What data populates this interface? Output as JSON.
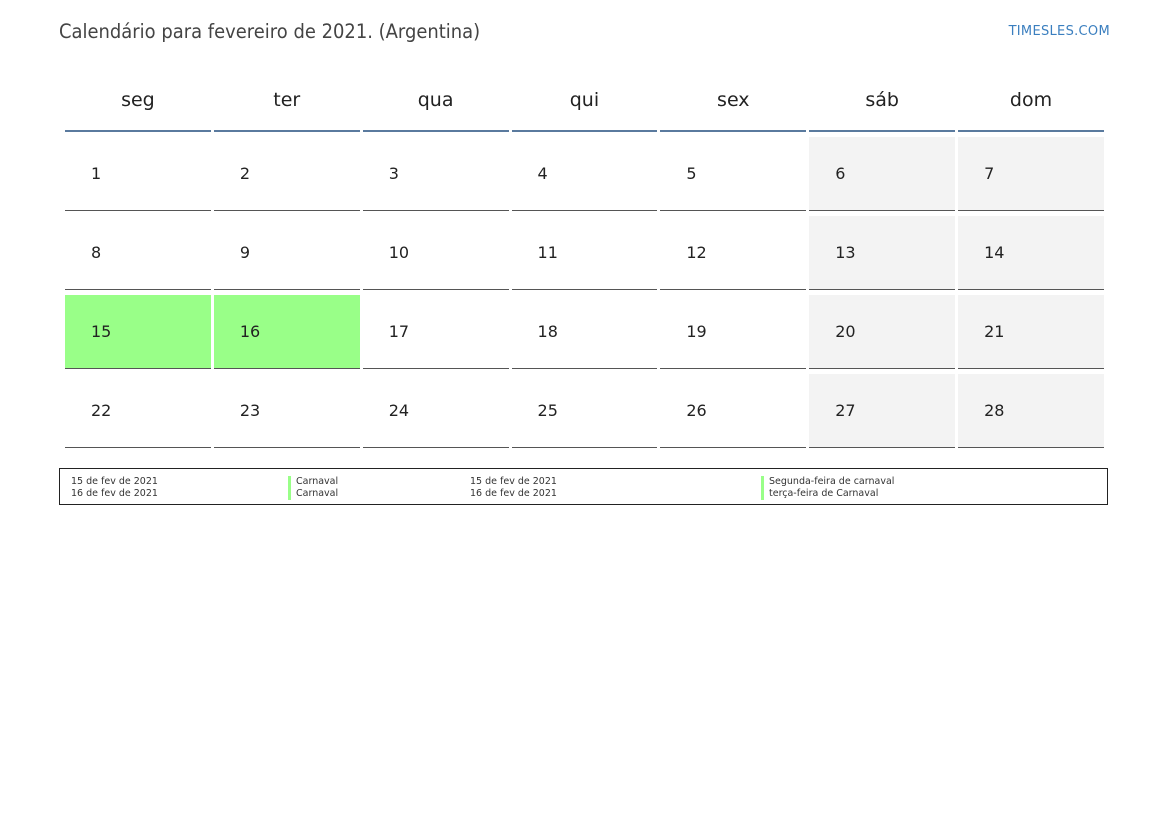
{
  "header": {
    "title": "Calendário para fevereiro de 2021. (Argentina)",
    "brand": "TIMESLES.COM"
  },
  "calendar": {
    "weekdays": [
      "seg",
      "ter",
      "qua",
      "qui",
      "sex",
      "sáb",
      "dom"
    ],
    "weeks": [
      [
        "1",
        "2",
        "3",
        "4",
        "5",
        "6",
        "7"
      ],
      [
        "8",
        "9",
        "10",
        "11",
        "12",
        "13",
        "14"
      ],
      [
        "15",
        "16",
        "17",
        "18",
        "19",
        "20",
        "21"
      ],
      [
        "22",
        "23",
        "24",
        "25",
        "26",
        "27",
        "28"
      ]
    ],
    "holiday_color": "#99ff88",
    "weekend_color": "#f3f3f3"
  },
  "legend": {
    "left": [
      {
        "date": "15 de fev de 2021",
        "name": "Carnaval"
      },
      {
        "date": "16 de fev de 2021",
        "name": "Carnaval"
      }
    ],
    "right": [
      {
        "date": "15 de fev de 2021",
        "name": "Segunda-feira de carnaval"
      },
      {
        "date": "16 de fev de 2021",
        "name": "terça-feira de Carnaval"
      }
    ]
  }
}
